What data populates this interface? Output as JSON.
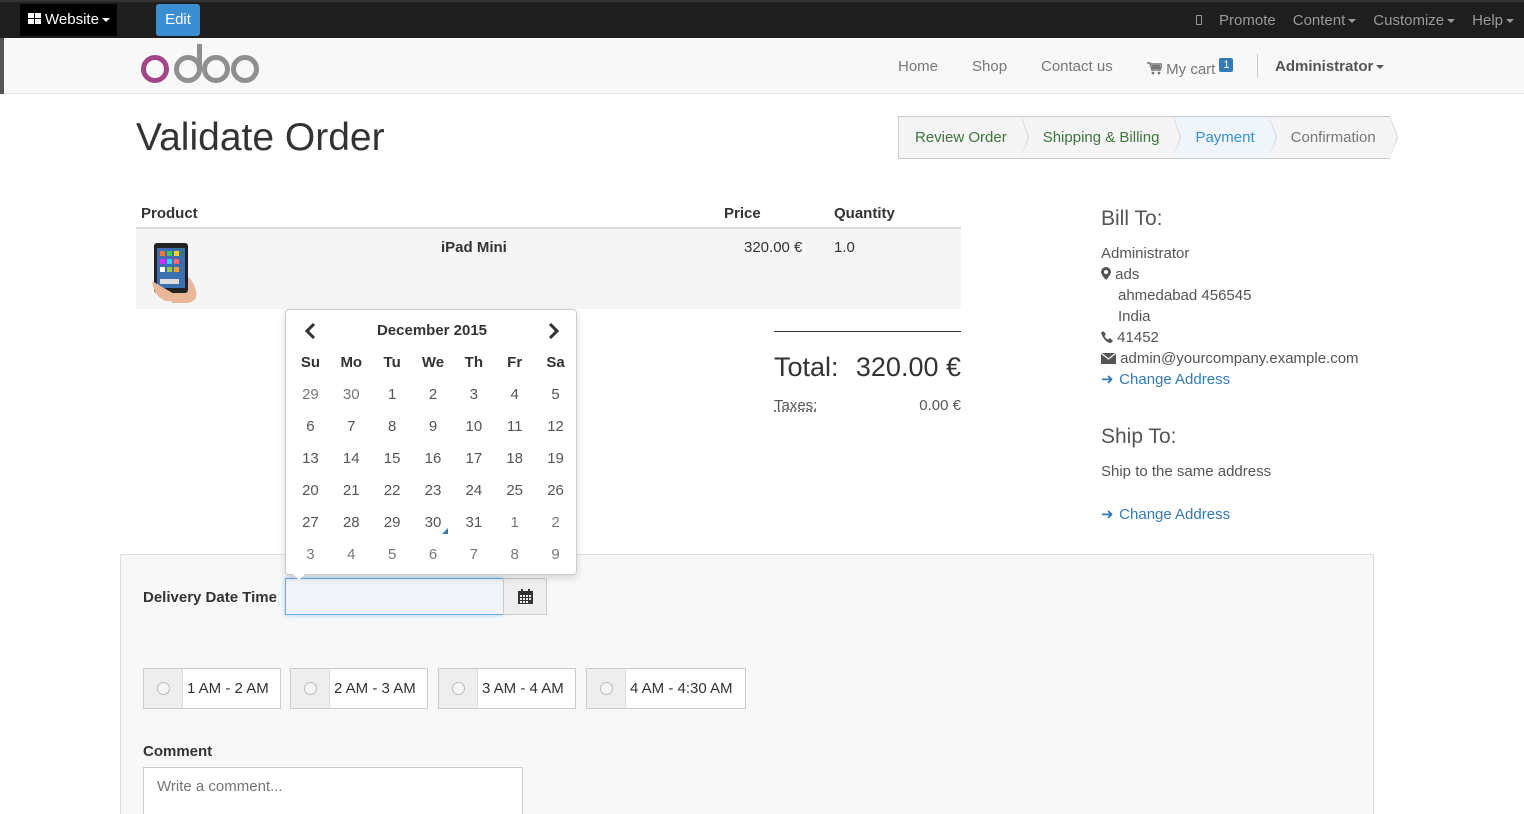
{
  "adminbar": {
    "website_label": "Website",
    "edit_label": "Edit",
    "promote_label": "Promote",
    "content_label": "Content",
    "customize_label": "Customize",
    "help_label": "Help"
  },
  "nav": {
    "logo_text": "odoo",
    "home": "Home",
    "shop": "Shop",
    "contact": "Contact us",
    "cart_label": "My cart",
    "cart_count": "1",
    "user": "Administrator"
  },
  "page": {
    "title": "Validate Order"
  },
  "wizard": {
    "steps": [
      "Review Order",
      "Shipping & Billing",
      "Payment",
      "Confirmation"
    ]
  },
  "order": {
    "headers": {
      "product": "Product",
      "price": "Price",
      "quantity": "Quantity"
    },
    "line": {
      "name": "iPad Mini",
      "price": "320.00 €",
      "quantity": "1.0"
    },
    "total_label": "Total:",
    "total_value": "320.00 €",
    "taxes_label": "Taxes:",
    "taxes_value": "0.00 €"
  },
  "bill_to": {
    "title": "Bill To:",
    "name": "Administrator",
    "street": "ads",
    "city": "ahmedabad 456545",
    "country": "India",
    "phone": "41452",
    "email": "admin@yourcompany.example.com",
    "change": "Change Address"
  },
  "ship_to": {
    "title": "Ship To:",
    "text": "Ship to the same address",
    "change": "Change Address"
  },
  "calendar": {
    "month": "December 2015",
    "weekdays": [
      "Su",
      "Mo",
      "Tu",
      "We",
      "Th",
      "Fr",
      "Sa"
    ],
    "weeks": [
      [
        "29",
        "30",
        "1",
        "2",
        "3",
        "4",
        "5"
      ],
      [
        "6",
        "7",
        "8",
        "9",
        "10",
        "11",
        "12"
      ],
      [
        "13",
        "14",
        "15",
        "16",
        "17",
        "18",
        "19"
      ],
      [
        "20",
        "21",
        "22",
        "23",
        "24",
        "25",
        "26"
      ],
      [
        "27",
        "28",
        "29",
        "30",
        "31",
        "1",
        "2"
      ],
      [
        "3",
        "4",
        "5",
        "6",
        "7",
        "8",
        "9"
      ]
    ]
  },
  "delivery": {
    "label": "Delivery Date Time",
    "value": "",
    "slots": [
      "1 AM - 2 AM",
      "2 AM - 3 AM",
      "3 AM - 4 AM",
      "4 AM - 4:30 AM"
    ],
    "comment_label": "Comment",
    "comment_placeholder": "Write a comment..."
  }
}
